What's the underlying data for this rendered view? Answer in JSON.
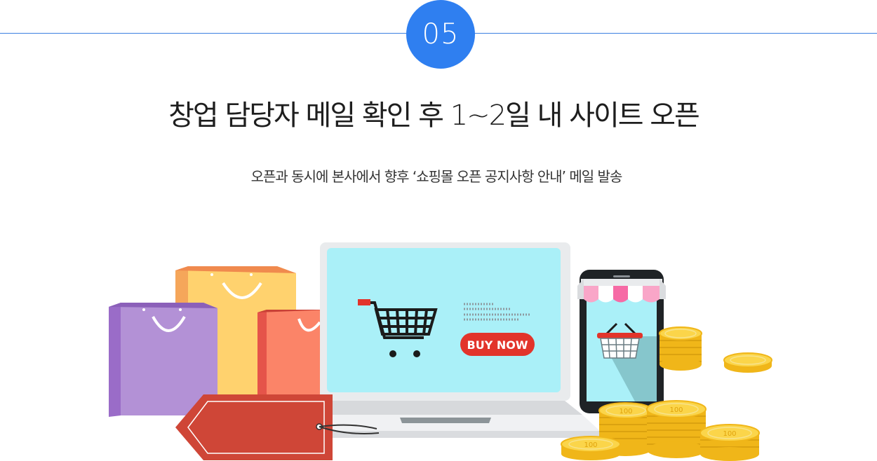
{
  "step": {
    "number": "05"
  },
  "headline": "창업 담당자 메일 확인 후 1~2일 내 사이트 오픈",
  "subline": "오픈과 동시에 본사에서 향후 ‘쇼핑몰 오픈 공지사항 안내’ 메일 발송",
  "illustration": {
    "button_label": "BUY NOW",
    "coin_label": "100",
    "icons": [
      "shopping-bag-icon",
      "price-tag-icon",
      "laptop-icon",
      "shopping-cart-icon",
      "smartphone-icon",
      "shopping-basket-icon",
      "coin-stack-icon"
    ],
    "colors": {
      "accent": "#2f7ff0",
      "screen": "#aaf0f8",
      "button": "#e2342b",
      "coin": "#f6c52a",
      "tag": "#cf4637"
    }
  }
}
